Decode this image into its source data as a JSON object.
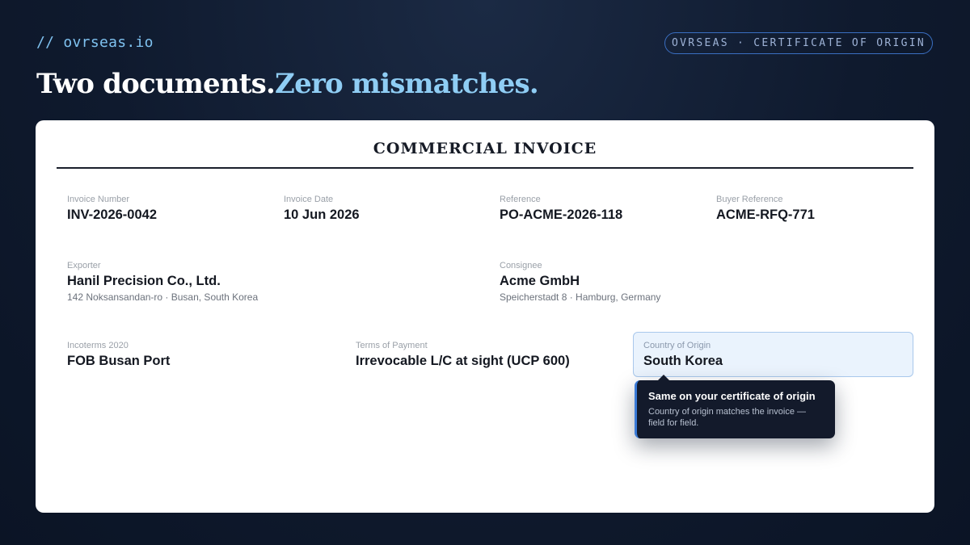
{
  "brand": "// ovrseas.io",
  "badge": "OVRSEAS · CERTIFICATE OF ORIGIN",
  "headline": {
    "part1": "Two documents.",
    "part2": "Zero mismatches."
  },
  "document": {
    "title": "COMMERCIAL INVOICE",
    "invoice_number": {
      "label": "Invoice Number",
      "value": "INV-2026-0042"
    },
    "invoice_date": {
      "label": "Invoice Date",
      "value": "10 Jun 2026"
    },
    "reference": {
      "label": "Reference",
      "value": "PO-ACME-2026-118"
    },
    "buyer_reference": {
      "label": "Buyer Reference",
      "value": "ACME-RFQ-771"
    },
    "exporter": {
      "label": "Exporter",
      "name": "Hanil Precision Co., Ltd.",
      "address": "142 Noksansandan-ro · Busan, South Korea"
    },
    "consignee": {
      "label": "Consignee",
      "name": "Acme GmbH",
      "address": "Speicherstadt 8 · Hamburg, Germany"
    },
    "incoterms": {
      "label": "Incoterms 2020",
      "value": "FOB Busan Port"
    },
    "payment_terms": {
      "label": "Terms of Payment",
      "value": "Irrevocable L/C at sight (UCP 600)"
    },
    "country_of_origin": {
      "label": "Country of Origin",
      "value": "South Korea"
    }
  },
  "tooltip": {
    "title": "Same on your certificate of origin",
    "body": "Country of origin matches the invoice — field for field."
  },
  "colors": {
    "accent": "#8fcdf4",
    "badge_border": "#3a6fc2",
    "highlight_bg": "#eaf3fd",
    "highlight_border": "#a9c8ec",
    "tooltip_bg": "#131a2b"
  }
}
